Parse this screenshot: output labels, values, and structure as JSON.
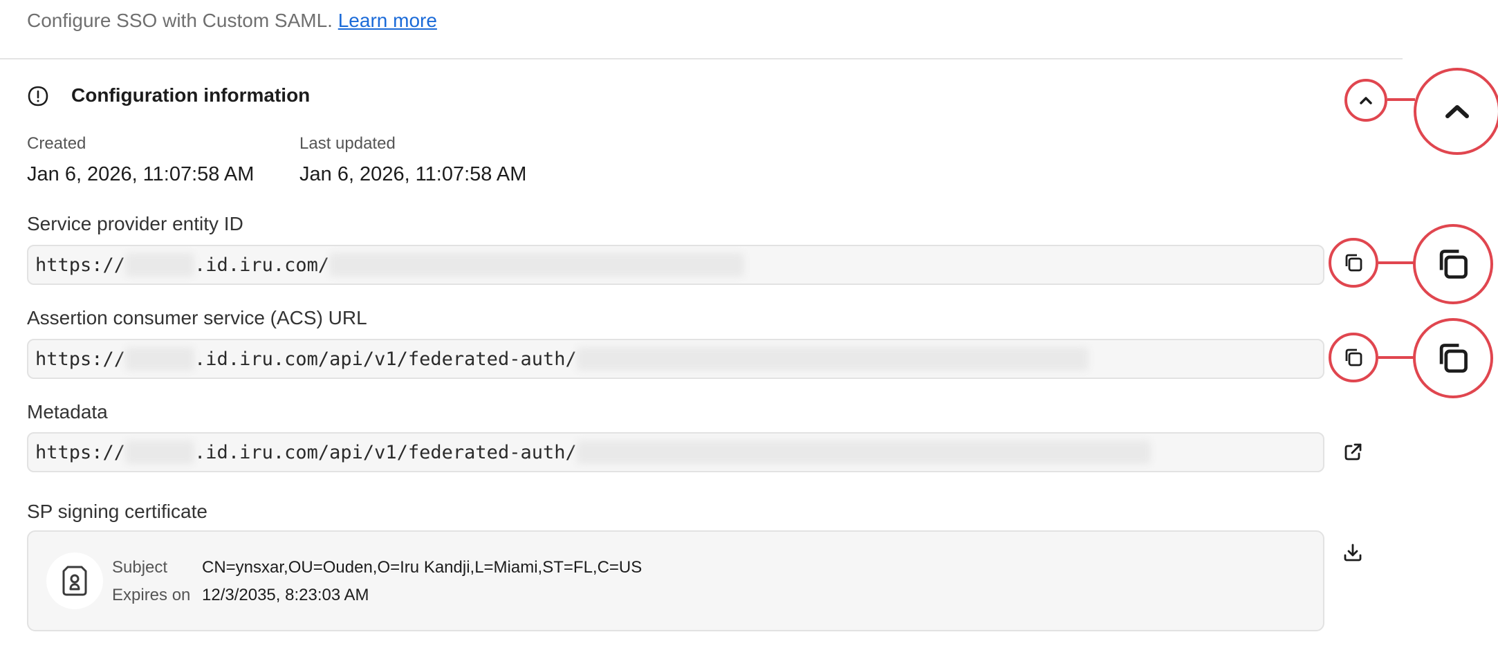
{
  "intro": {
    "text": "Configure SSO with Custom SAML.",
    "link": "Learn more"
  },
  "section": {
    "title": "Configuration information"
  },
  "meta": {
    "created_label": "Created",
    "created_value": "Jan 6, 2026, 11:07:58 AM",
    "updated_label": "Last updated",
    "updated_value": "Jan 6, 2026, 11:07:58 AM"
  },
  "fields": {
    "entity_id": {
      "label": "Service provider entity ID",
      "prefix": "https://",
      "host": ".id.iru.com/"
    },
    "acs_url": {
      "label": "Assertion consumer service (ACS) URL",
      "prefix": "https://",
      "host": ".id.iru.com/api/v1/federated-auth/"
    },
    "metadata": {
      "label": "Metadata",
      "prefix": "https://",
      "host": ".id.iru.com/api/v1/federated-auth/"
    }
  },
  "certificate": {
    "label": "SP signing certificate",
    "subject_label": "Subject",
    "subject_value": "CN=ynsxar,OU=Ouden,O=Iru Kandji,L=Miami,ST=FL,C=US",
    "expires_label": "Expires on",
    "expires_value": "12/3/2035, 8:23:03 AM"
  },
  "icons": {
    "info": "info-circle-icon",
    "collapse": "chevron-up-icon",
    "copy": "copy-icon",
    "external": "external-link-icon",
    "download": "download-icon",
    "certificate": "certificate-badge-icon"
  },
  "colors": {
    "accent_link": "#1a6ad8",
    "callout": "#e0464f"
  }
}
